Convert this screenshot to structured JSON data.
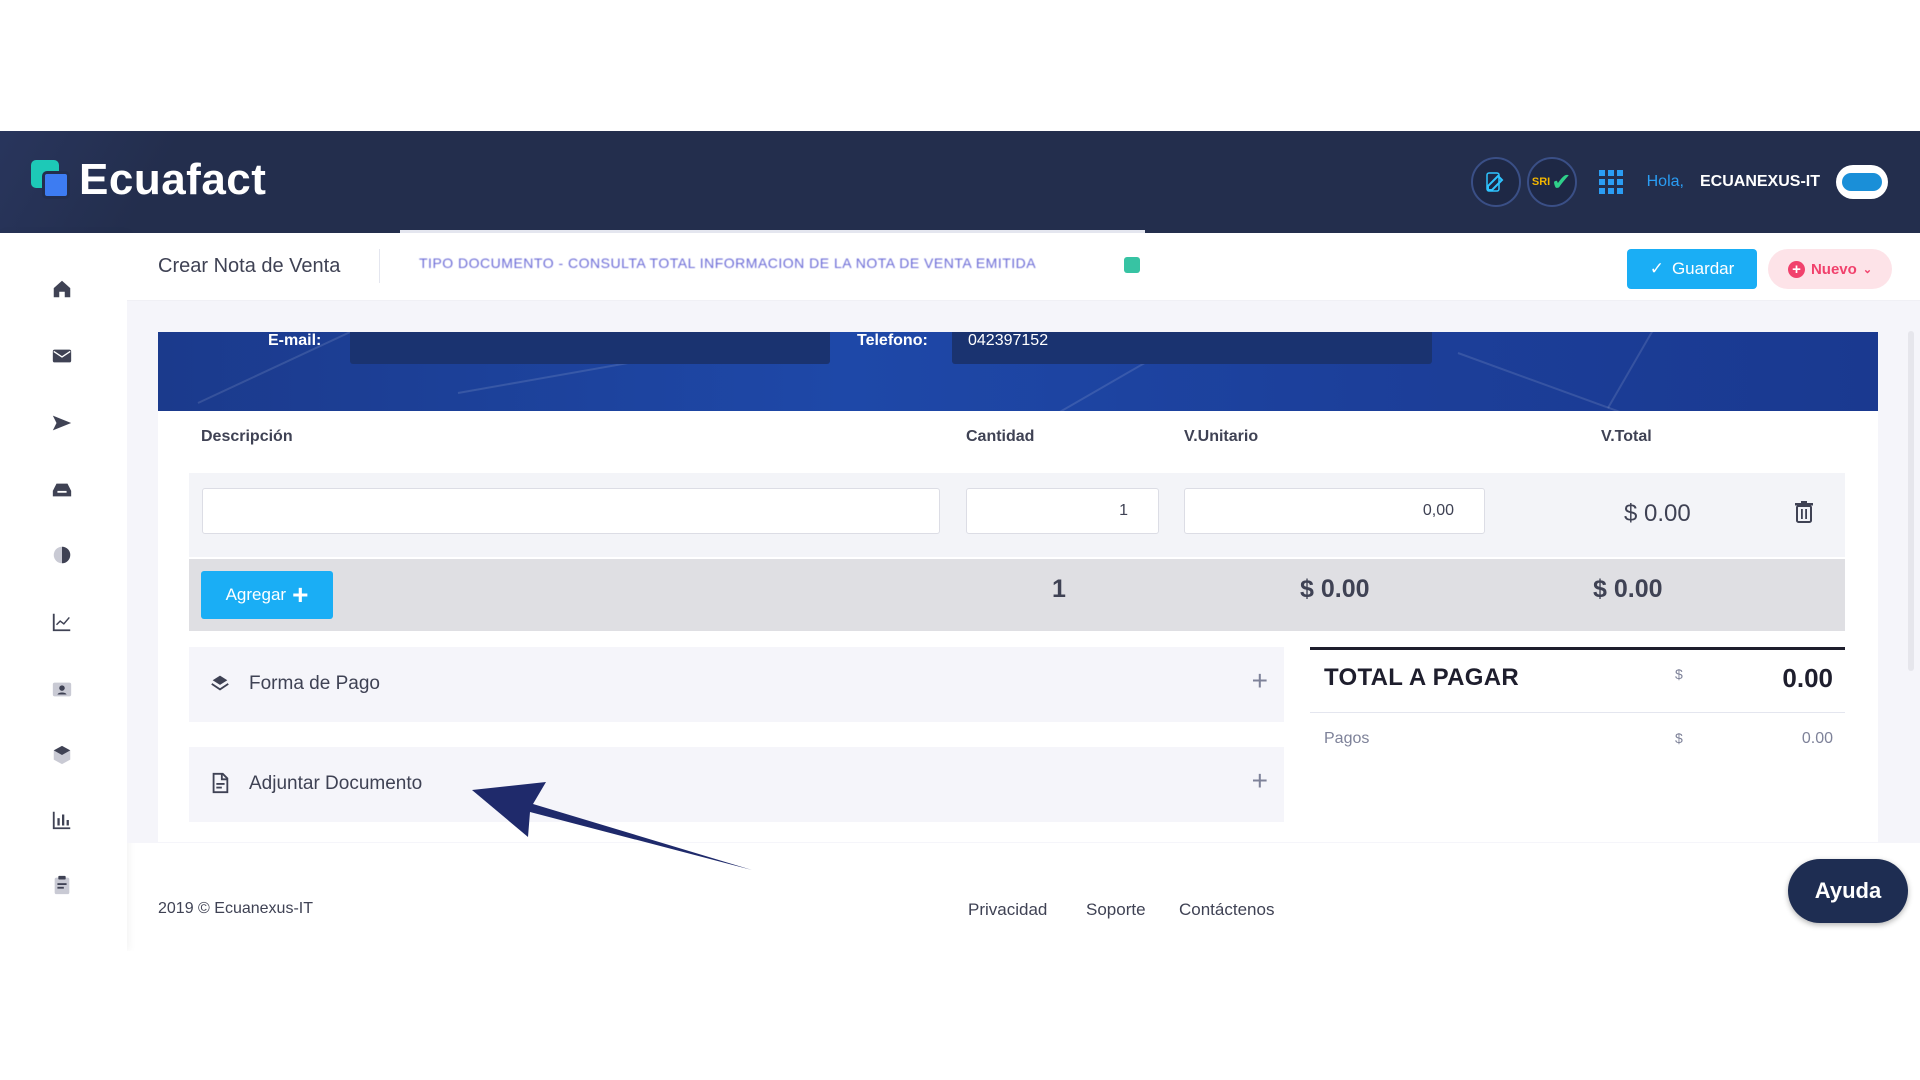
{
  "header": {
    "brand": "Ecuafact",
    "sri_label": "SRI",
    "greeting": "Hola,",
    "username": "ECUANEXUS-IT"
  },
  "subheader": {
    "title": "Crear Nota de Venta",
    "doc_info": "TIPO DOCUMENTO - CONSULTA TOTAL INFORMACION DE LA NOTA DE VENTA EMITIDA",
    "save_label": "Guardar",
    "new_label": "Nuevo"
  },
  "client": {
    "email_label": "E-mail:",
    "email_value": "",
    "phone_label": "Telefono:",
    "phone_value": "042397152"
  },
  "table": {
    "headers": {
      "description": "Descripción",
      "quantity": "Cantidad",
      "unit_price": "V.Unitario",
      "total": "V.Total"
    },
    "row": {
      "description": "",
      "quantity": "1",
      "unit_price": "0,00",
      "total": "$ 0.00"
    },
    "totals": {
      "add_label": "Agregar",
      "quantity": "1",
      "unit_price": "$ 0.00",
      "total": "$ 0.00"
    }
  },
  "sections": {
    "payment_method": "Forma de Pago",
    "attach_document": "Adjuntar Documento"
  },
  "summary": {
    "total_label": "TOTAL A PAGAR",
    "currency": "$",
    "total_value": "0.00",
    "payments_label": "Pagos",
    "payments_currency": "$",
    "payments_value": "0.00"
  },
  "footer": {
    "copyright": "2019 © Ecuanexus-IT",
    "links": [
      "Privacidad",
      "Soporte",
      "Contáctenos"
    ]
  },
  "help_label": "Ayuda",
  "colors": {
    "header_bg": "#232e4d",
    "accent_blue": "#1aaef5",
    "danger": "#f1416c",
    "band_blue": "#1e48a8",
    "annotation_arrow": "#1f2a6b"
  },
  "icons": {
    "sidebar": [
      "home-icon",
      "mail-icon",
      "send-icon",
      "inbox-icon",
      "pie-chart-icon",
      "line-chart-icon",
      "contacts-icon",
      "box-icon",
      "bar-chart-icon",
      "clipboard-icon"
    ],
    "payment": "money-icon",
    "attach": "file-icon",
    "delete": "trash-icon"
  }
}
